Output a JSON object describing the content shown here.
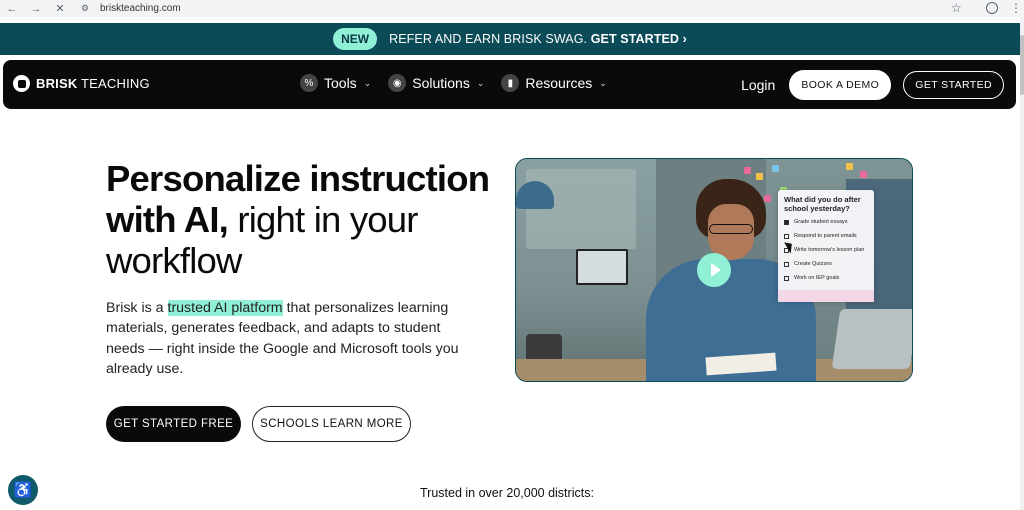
{
  "browser": {
    "url": "briskteaching.com",
    "back_icon": "←",
    "forward_icon": "→",
    "stop_icon": "✕",
    "site_info_icon": "⚙",
    "bookmark_icon": "☆",
    "menu_icon": "⋮"
  },
  "promo": {
    "badge": "NEW",
    "text": "REFER AND EARN BRISK SWAG.",
    "link": "GET STARTED",
    "chevron": "›"
  },
  "navbar": {
    "brand_bold": "BRISK",
    "brand_light": "TEACHING",
    "items": [
      {
        "label": "Tools",
        "icon": "%"
      },
      {
        "label": "Solutions",
        "icon": "◉"
      },
      {
        "label": "Resources",
        "icon": "▮"
      }
    ],
    "chevron": "⌄",
    "login": "Login",
    "book_demo": "BOOK A DEMO",
    "get_started": "GET STARTED"
  },
  "hero": {
    "headline_bold_1": "Personalize instruction",
    "headline_bold_2": "with AI,",
    "headline_light_2": " right in your",
    "headline_light_3": "workflow",
    "desc_pre": "Brisk is a ",
    "desc_highlight": "trusted AI platform",
    "desc_post": " that personalizes learning materials, generates feedback, and adapts to student needs — right inside the Google and Microsoft tools you already use.",
    "cta_primary": "GET STARTED FREE",
    "cta_secondary": "SCHOOLS LEARN MORE"
  },
  "video": {
    "note_question": "What did you do after school yesterday?",
    "note_items": [
      "Grade student essays",
      "Respond to parent emails",
      "Write tomorrow's lesson plan",
      "Create Quizzes",
      "Work on IEP goals"
    ]
  },
  "footer": {
    "trusted": "Trusted in over 20,000 districts:",
    "a11y_icon": "♿"
  },
  "colors": {
    "accent": "#8ff0d6",
    "banner": "#0b4a57",
    "nav": "#0a0a0a"
  }
}
